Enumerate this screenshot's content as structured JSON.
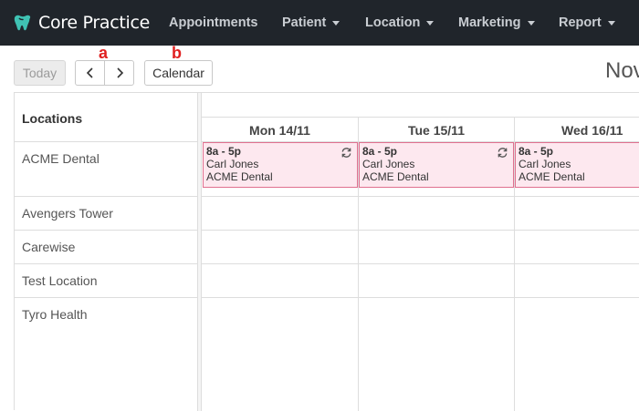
{
  "brand": {
    "name": "Core Practice",
    "logo_icon": "tooth-icon"
  },
  "nav": {
    "items": [
      {
        "label": "Appointments",
        "has_caret": false
      },
      {
        "label": "Patient",
        "has_caret": true
      },
      {
        "label": "Location",
        "has_caret": true
      },
      {
        "label": "Marketing",
        "has_caret": true
      },
      {
        "label": "Report",
        "has_caret": true
      }
    ]
  },
  "toolbar": {
    "today_label": "Today",
    "prev_icon": "chevron-left-icon",
    "next_icon": "chevron-right-icon",
    "calendar_label": "Calendar",
    "annotation_a": "a",
    "annotation_b": "b",
    "title": "Nov"
  },
  "grid": {
    "locations_header": "Locations",
    "locations": [
      "ACME Dental",
      "Avengers Tower",
      "Carewise",
      "Test Location",
      "Tyro Health"
    ],
    "days": [
      "Mon 14/11",
      "Tue 15/11",
      "Wed 16/11"
    ],
    "events": [
      {
        "time": "8a - 5p",
        "person": "Carl Jones",
        "location": "ACME Dental",
        "icon": "sync-icon"
      },
      {
        "time": "8a - 5p",
        "person": "Carl Jones",
        "location": "ACME Dental",
        "icon": "sync-icon"
      },
      {
        "time": "8a - 5p",
        "person": "Carl Jones",
        "location": "ACME Dental",
        "icon": "sync-icon"
      }
    ]
  },
  "colors": {
    "navbar": "#20252b",
    "event_bg": "#fde8ef",
    "event_border": "#e0708f",
    "annotation": "#e02020"
  }
}
